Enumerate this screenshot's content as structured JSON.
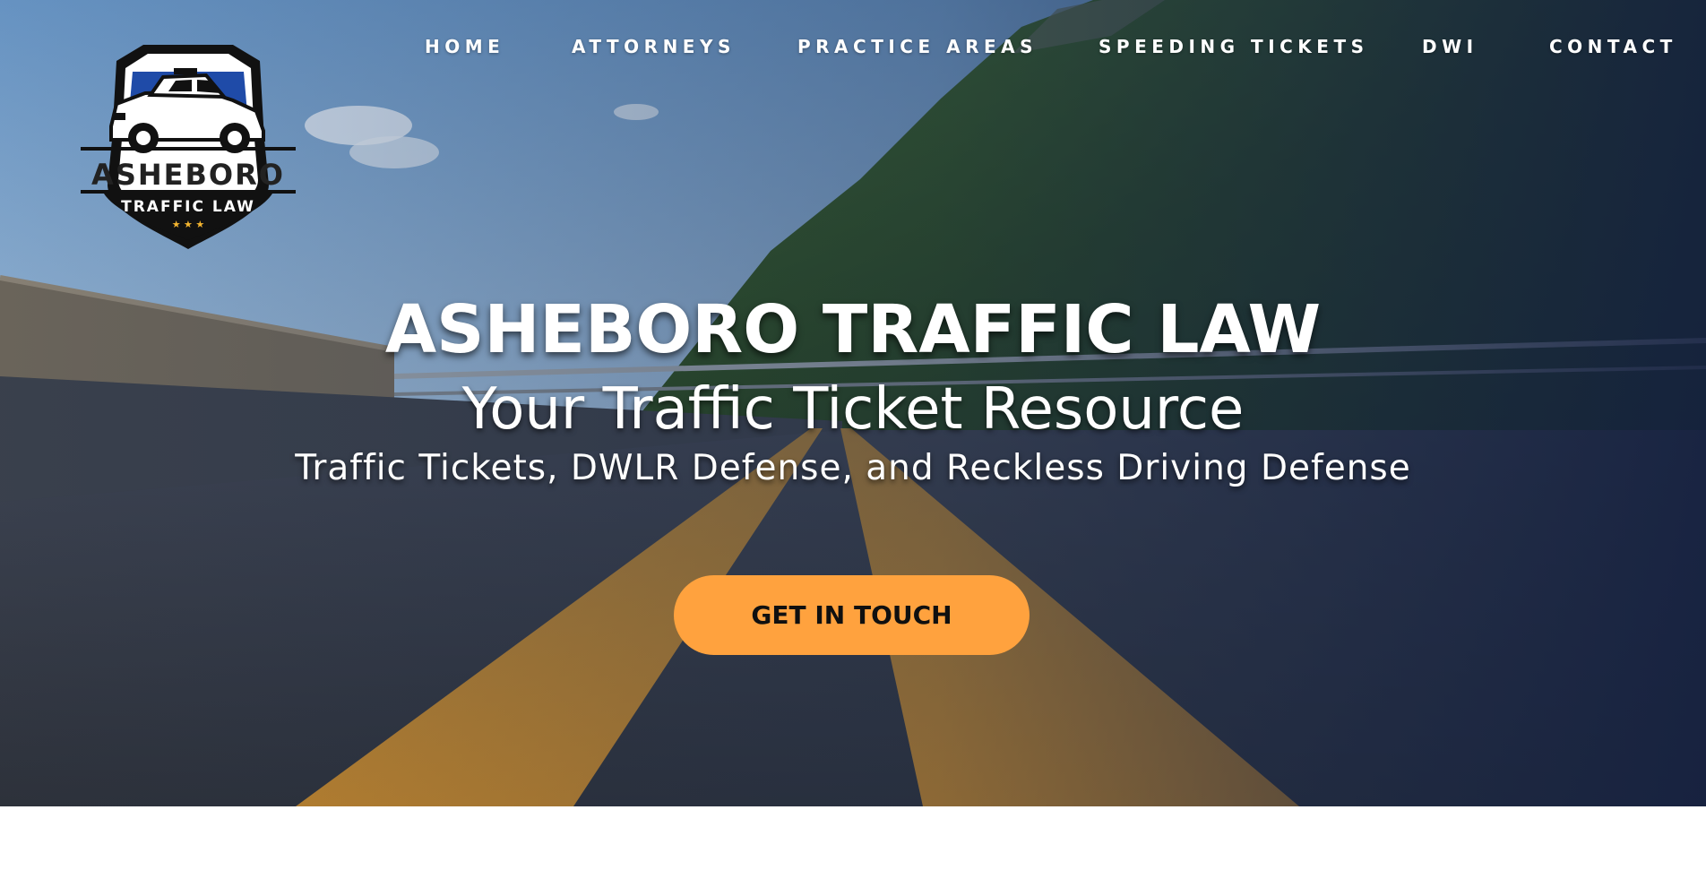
{
  "brand": {
    "logo_top_text": "ASHEBORO",
    "logo_bottom_text": "TRAFFIC LAW",
    "logo_stars": "★ ★ ★"
  },
  "nav": {
    "items": [
      {
        "label": "HOME"
      },
      {
        "label": "ATTORNEYS"
      },
      {
        "label": "PRACTICE AREAS"
      },
      {
        "label": "SPEEDING TICKETS"
      },
      {
        "label": "DWI"
      },
      {
        "label": "CONTACT"
      }
    ]
  },
  "hero": {
    "title": "ASHEBORO TRAFFIC LAW",
    "subtitle": "Your Traffic Ticket Resource",
    "tagline": "Traffic Tickets, DWLR Defense, and Reckless Driving Defense",
    "cta_label": "GET IN TOUCH"
  },
  "colors": {
    "accent": "#ffa23e",
    "overlay": "#1b2a48",
    "road_line": "#c98a2c",
    "logo_navy": "#163a8f"
  }
}
